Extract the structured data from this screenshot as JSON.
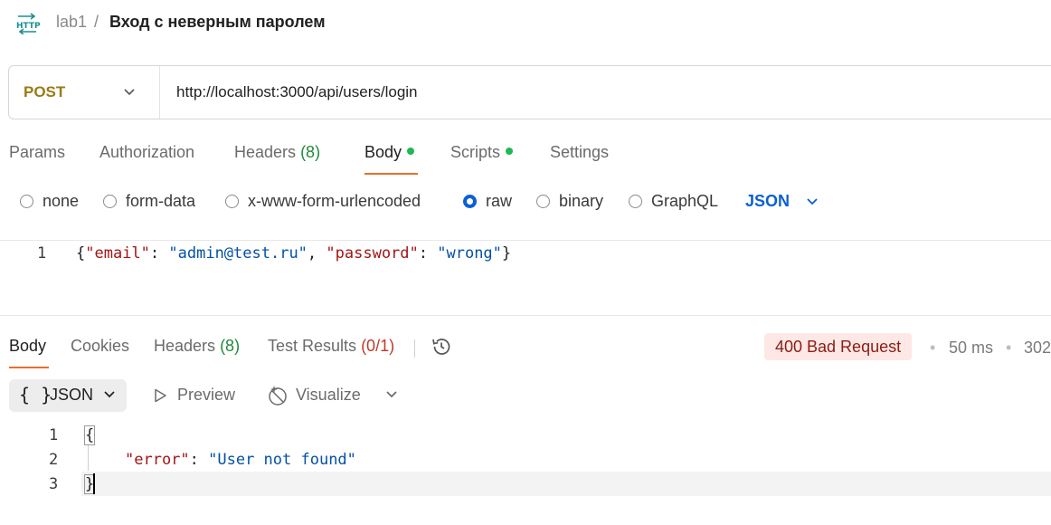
{
  "breadcrumb": {
    "icon": "http-icon",
    "parent": "lab1",
    "separator": "/",
    "title": "Вход с неверным паролем"
  },
  "request": {
    "method": "POST",
    "url": "http://localhost:3000/api/users/login"
  },
  "request_tabs": {
    "params": "Params",
    "authorization": "Authorization",
    "headers": "Headers",
    "headers_count": "(8)",
    "body": "Body",
    "scripts": "Scripts",
    "settings": "Settings",
    "active": "Body"
  },
  "body_types": {
    "none": "none",
    "form_data": "form-data",
    "urlencoded": "x-www-form-urlencoded",
    "raw": "raw",
    "binary": "binary",
    "graphql": "GraphQL",
    "selected": "raw",
    "language": "JSON"
  },
  "request_editor": {
    "line_number": "1",
    "open": "{",
    "key1": "\"email\"",
    "colon": ": ",
    "val1": "\"admin@test.ru\"",
    "comma": ", ",
    "key2": "\"password\"",
    "val2": "\"wrong\"",
    "close": "}"
  },
  "response_tabs": {
    "body": "Body",
    "cookies": "Cookies",
    "headers": "Headers",
    "headers_count": "(8)",
    "test_results": "Test Results",
    "test_count": "(0/1)",
    "active": "Body"
  },
  "response_meta": {
    "status": "400 Bad Request",
    "time": "50 ms",
    "size": "302",
    "separator": "•"
  },
  "response_toolbar": {
    "format_brace": "{ }",
    "format": "JSON",
    "preview": "Preview",
    "visualize": "Visualize"
  },
  "response_editor": {
    "lines": [
      "1",
      "2",
      "3"
    ],
    "open": "{",
    "key": "\"error\"",
    "colon": ": ",
    "value": "\"User not found\"",
    "close": "}"
  },
  "colors": {
    "method": "#9a7a16",
    "accent": "#e8702a",
    "link": "#0a5fd6",
    "status_bg": "#fde8e6",
    "status_text": "#8c1c13",
    "json_key": "#a31515",
    "json_string": "#0451a5"
  }
}
